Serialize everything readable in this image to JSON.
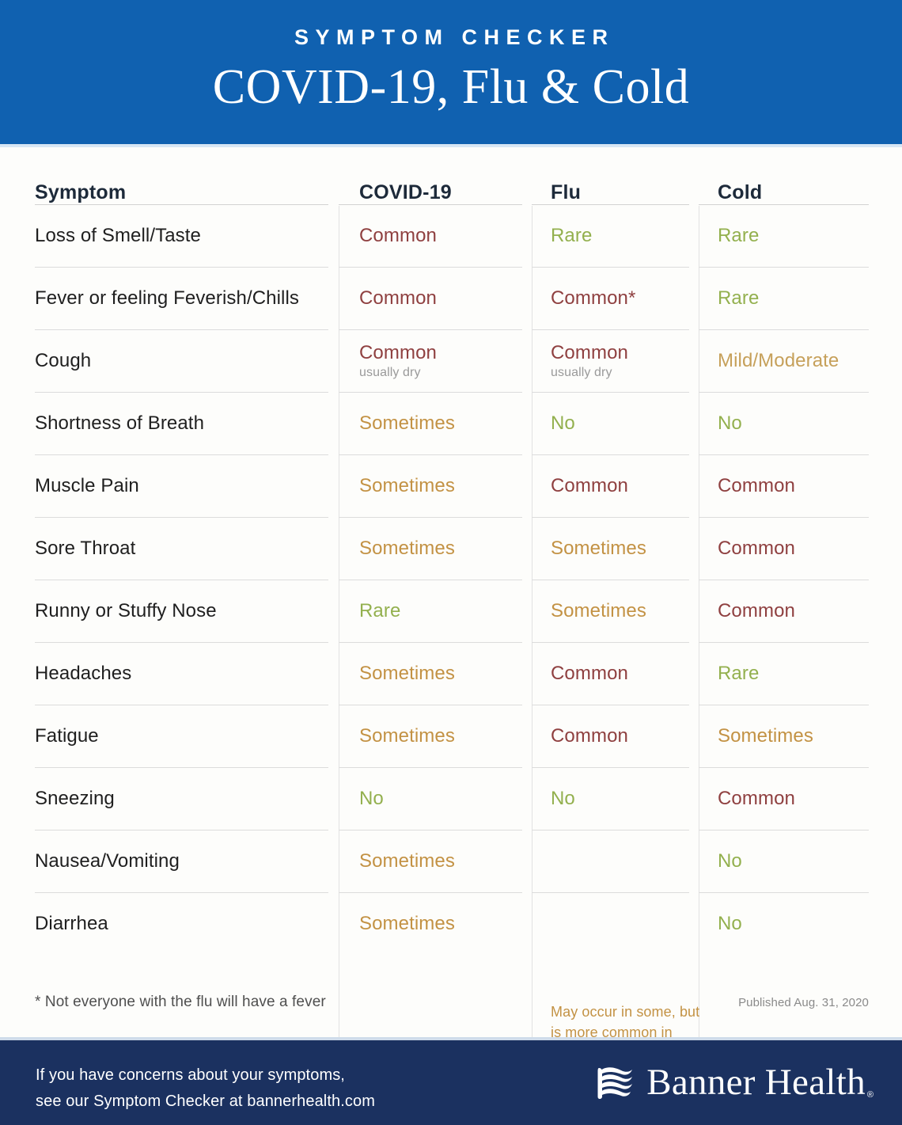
{
  "header": {
    "eyebrow": "SYMPTOM CHECKER",
    "title": "COVID-19, Flu & Cold",
    "background_color": "#1061B0"
  },
  "table": {
    "columns": [
      {
        "key": "symptom",
        "label": "Symptom"
      },
      {
        "key": "covid",
        "label": "COVID-19"
      },
      {
        "key": "flu",
        "label": "Flu"
      },
      {
        "key": "cold",
        "label": "Cold"
      }
    ],
    "rows": [
      {
        "symptom": "Loss of Smell/Taste",
        "covid": {
          "value": "Common",
          "level": "common"
        },
        "flu": {
          "value": "Rare",
          "level": "rare"
        },
        "cold": {
          "value": "Rare",
          "level": "rare"
        }
      },
      {
        "symptom": "Fever or feeling Feverish/Chills",
        "covid": {
          "value": "Common",
          "level": "common"
        },
        "flu": {
          "value": "Common*",
          "level": "common"
        },
        "cold": {
          "value": "Rare",
          "level": "rare"
        }
      },
      {
        "symptom": "Cough",
        "covid": {
          "value": "Common",
          "sub": "usually dry",
          "level": "common"
        },
        "flu": {
          "value": "Common",
          "sub": "usually dry",
          "level": "common"
        },
        "cold": {
          "value": "Mild/Moderate",
          "level": "mild"
        }
      },
      {
        "symptom": "Shortness of Breath",
        "covid": {
          "value": "Sometimes",
          "level": "sometimes"
        },
        "flu": {
          "value": "No",
          "level": "no"
        },
        "cold": {
          "value": "No",
          "level": "no"
        }
      },
      {
        "symptom": "Muscle Pain",
        "covid": {
          "value": "Sometimes",
          "level": "sometimes"
        },
        "flu": {
          "value": "Common",
          "level": "common"
        },
        "cold": {
          "value": "Common",
          "level": "common"
        }
      },
      {
        "symptom": "Sore Throat",
        "covid": {
          "value": "Sometimes",
          "level": "sometimes"
        },
        "flu": {
          "value": "Sometimes",
          "level": "sometimes"
        },
        "cold": {
          "value": "Common",
          "level": "common"
        }
      },
      {
        "symptom": "Runny or Stuffy Nose",
        "covid": {
          "value": "Rare",
          "level": "rare"
        },
        "flu": {
          "value": "Sometimes",
          "level": "sometimes"
        },
        "cold": {
          "value": "Common",
          "level": "common"
        }
      },
      {
        "symptom": "Headaches",
        "covid": {
          "value": "Sometimes",
          "level": "sometimes"
        },
        "flu": {
          "value": "Common",
          "level": "common"
        },
        "cold": {
          "value": "Rare",
          "level": "rare"
        }
      },
      {
        "symptom": "Fatigue",
        "covid": {
          "value": "Sometimes",
          "level": "sometimes"
        },
        "flu": {
          "value": "Common",
          "level": "common"
        },
        "cold": {
          "value": "Sometimes",
          "level": "sometimes"
        }
      },
      {
        "symptom": "Sneezing",
        "covid": {
          "value": "No",
          "level": "no"
        },
        "flu": {
          "value": "No",
          "level": "no"
        },
        "cold": {
          "value": "Common",
          "level": "common"
        }
      },
      {
        "symptom": "Nausea/Vomiting",
        "covid": {
          "value": "Sometimes",
          "level": "sometimes"
        },
        "flu": {
          "value": "",
          "level": "note",
          "merged": true
        },
        "cold": {
          "value": "No",
          "level": "no"
        }
      },
      {
        "symptom": "Diarrhea",
        "covid": {
          "value": "Sometimes",
          "level": "sometimes"
        },
        "flu": {
          "value": "",
          "level": "note",
          "merged": true
        },
        "cold": {
          "value": "No",
          "level": "no"
        }
      }
    ],
    "flu_merged_note": "May occur in some, but is more common in children"
  },
  "footnote": {
    "text": "* Not everyone with the flu will have a fever",
    "published": "Published Aug. 31, 2020"
  },
  "footer": {
    "line1": "If you have concerns about your symptoms,",
    "line2": "see our Symptom Checker at bannerhealth.com",
    "brand_name": "Banner Health",
    "brand_reg": "®",
    "background_color": "#1B3160"
  },
  "legend_colors": {
    "common": "#8f4040",
    "rare": "#93b04e",
    "no": "#93b04e",
    "sometimes": "#c39244",
    "mild": "#c6a05a",
    "note": "#c39244"
  }
}
